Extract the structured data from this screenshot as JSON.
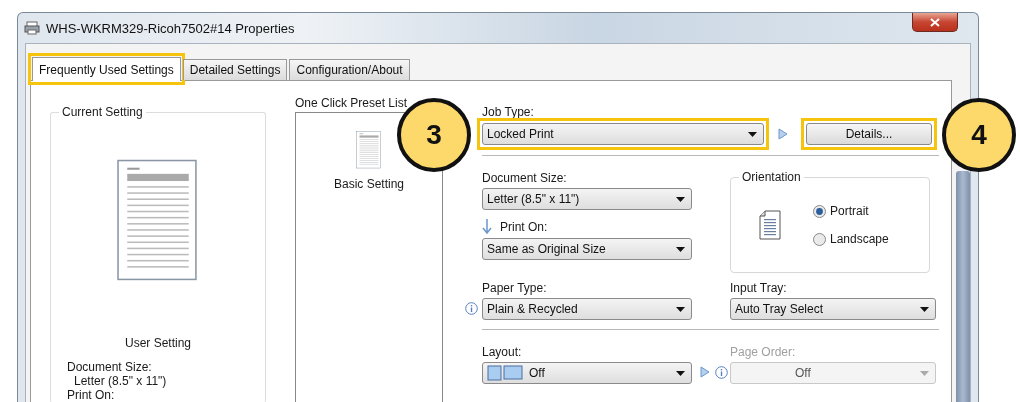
{
  "window": {
    "title": "WHS-WKRM329-Ricoh7502#14 Properties"
  },
  "tabs": [
    {
      "label": "Frequently Used Settings",
      "selected": true,
      "highlighted": true
    },
    {
      "label": "Detailed Settings",
      "selected": false,
      "highlighted": false
    },
    {
      "label": "Configuration/About",
      "selected": false,
      "highlighted": false
    }
  ],
  "current_setting": {
    "title": "Current Setting",
    "caption": "User Setting",
    "summary": [
      {
        "kind": "label",
        "text": "Document Size:"
      },
      {
        "kind": "value",
        "text": "Letter (8.5\" x 11\")"
      },
      {
        "kind": "label",
        "text": "Print On:"
      }
    ]
  },
  "preset_list": {
    "title": "One Click Preset List",
    "items": [
      {
        "label": "Basic Setting",
        "selected": false
      }
    ]
  },
  "job_type": {
    "label": "Job Type:",
    "value": "Locked Print",
    "highlighted": true,
    "callout": "3"
  },
  "details_button": {
    "label": "Details...",
    "highlighted": true,
    "callout": "4"
  },
  "document_size": {
    "label": "Document Size:",
    "value": "Letter (8.5\" x 11\")"
  },
  "print_on": {
    "label": "Print On:",
    "value": "Same as Original Size"
  },
  "orientation": {
    "title": "Orientation",
    "options": [
      {
        "label": "Portrait",
        "selected": true
      },
      {
        "label": "Landscape",
        "selected": false
      }
    ]
  },
  "paper_type": {
    "label": "Paper Type:",
    "value": "Plain & Recycled"
  },
  "input_tray": {
    "label": "Input Tray:",
    "value": "Auto Tray Select"
  },
  "layout": {
    "label": "Layout:",
    "value": "Off"
  },
  "page_order": {
    "label": "Page Order:",
    "value": "Off",
    "disabled": true
  }
}
